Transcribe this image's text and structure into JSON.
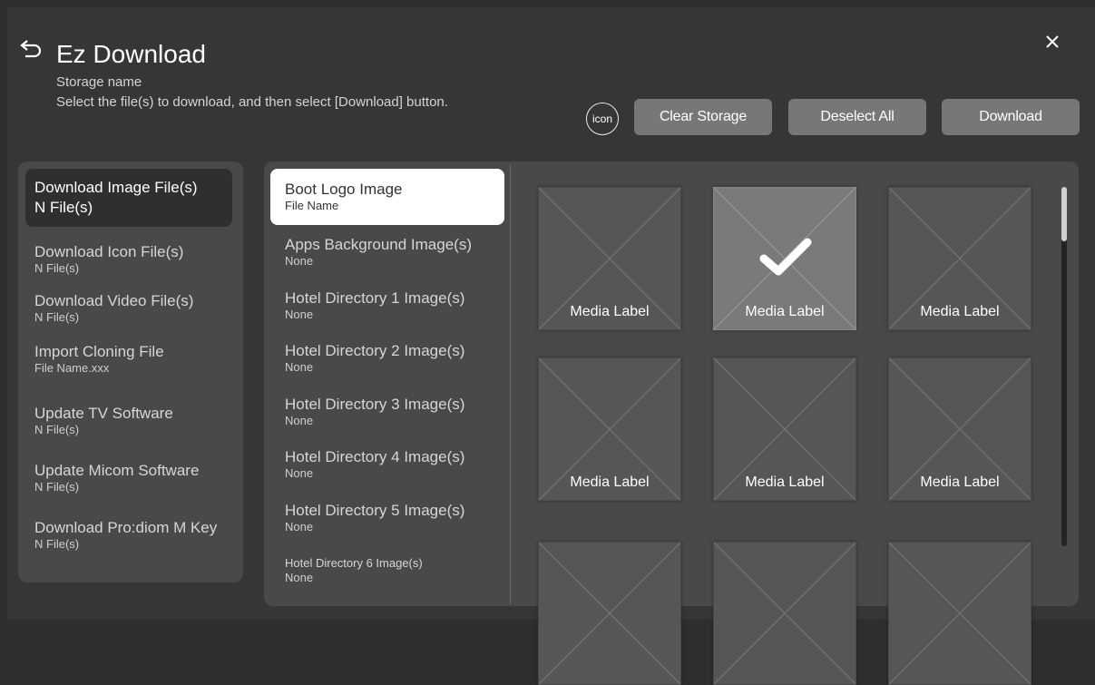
{
  "header": {
    "title": "Ez Download",
    "storage_name": "Storage name",
    "instructions": "Select the file(s) to download, and then select [Download] button.",
    "icon_label": "icon",
    "buttons": {
      "clear_storage": "Clear Storage",
      "deselect_all": "Deselect All",
      "download": "Download"
    }
  },
  "nav": {
    "items": [
      {
        "label": "Download Image File(s)",
        "sub": "N File(s)"
      },
      {
        "label": "Download Icon File(s)",
        "sub": "N File(s)"
      },
      {
        "label": "Download Video File(s)",
        "sub": "N File(s)"
      },
      {
        "label": "Import Cloning File",
        "sub": "File Name.xxx"
      },
      {
        "label": "Update TV Software",
        "sub": "N File(s)"
      },
      {
        "label": "Update Micom Software",
        "sub": "N File(s)"
      },
      {
        "label": "Download Pro:diom M Key",
        "sub": "N File(s)"
      }
    ]
  },
  "files": {
    "items": [
      {
        "label": "Boot Logo Image",
        "sub": "File Name"
      },
      {
        "label": "Apps Background Image(s)",
        "sub": "None"
      },
      {
        "label": "Hotel Directory 1 Image(s)",
        "sub": "None"
      },
      {
        "label": "Hotel Directory 2 Image(s)",
        "sub": "None"
      },
      {
        "label": "Hotel Directory 3 Image(s)",
        "sub": "None"
      },
      {
        "label": "Hotel Directory 4 Image(s)",
        "sub": "None"
      },
      {
        "label": "Hotel Directory 5 Image(s)",
        "sub": "None"
      },
      {
        "label": "Hotel Directory 6 Image(s)",
        "sub": "None"
      }
    ]
  },
  "media": {
    "items": [
      {
        "label": "Media Label",
        "selected": false
      },
      {
        "label": "Media Label",
        "selected": true
      },
      {
        "label": "Media Label",
        "selected": false
      },
      {
        "label": "Media Label",
        "selected": false
      },
      {
        "label": "Media Label",
        "selected": false
      },
      {
        "label": "Media Label",
        "selected": false
      },
      {
        "label": "",
        "selected": false
      },
      {
        "label": "",
        "selected": false
      },
      {
        "label": "",
        "selected": false
      }
    ]
  },
  "icons": {
    "back": "back-arrow-icon",
    "close": "close-icon",
    "check": "checkmark-icon",
    "placeholder": "image-placeholder-icon"
  },
  "colors": {
    "background": "#363636",
    "panel": "#494949",
    "button": "#777777",
    "selected_nav": "#2f2f2f",
    "selected_file": "#ffffff"
  }
}
